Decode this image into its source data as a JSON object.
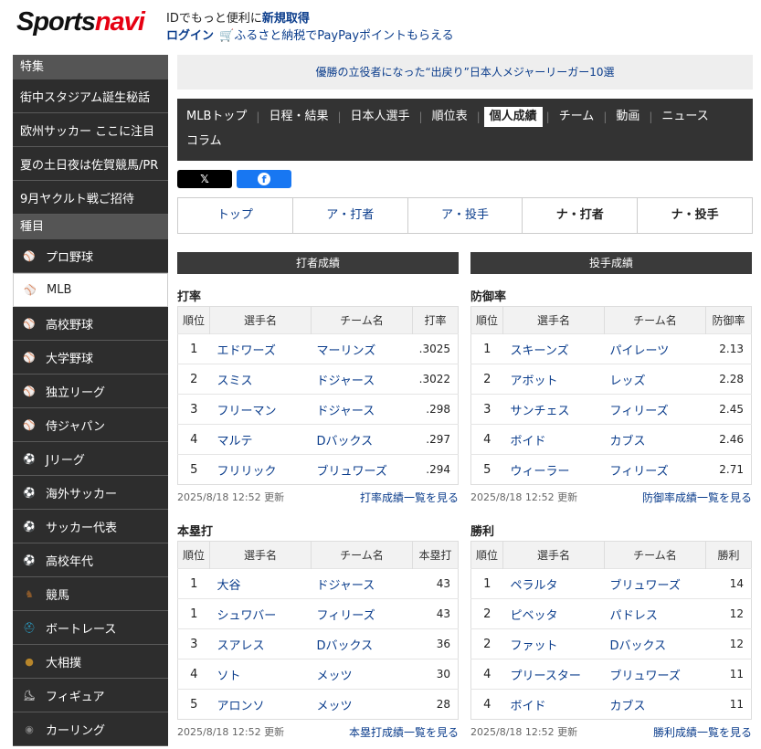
{
  "header": {
    "logo_main": "Sports",
    "logo_accent": "navi",
    "id_text": "IDでもっと便利に",
    "register": "新規取得",
    "login": "ログイン",
    "furusato": "ふるさと納税でPayPayポイントもらえる"
  },
  "sidebar": {
    "features_head": "特集",
    "features": [
      "街中スタジアム誕生秘話",
      "欧州サッカー ここに注目",
      "夏の土日夜は佐賀競馬/PR",
      "9月ヤクルト戦ご招待"
    ],
    "sports_head": "種目",
    "sports": [
      {
        "label": "プロ野球",
        "icon": "baseball-bat-icon",
        "color": "#888888"
      },
      {
        "label": "MLB",
        "icon": "mlb-icon",
        "color": "#d0021b"
      },
      {
        "label": "高校野球",
        "icon": "baseball-bat-icon",
        "color": "#999999"
      },
      {
        "label": "大学野球",
        "icon": "baseball-bat-icon",
        "color": "#2e8b57"
      },
      {
        "label": "独立リーグ",
        "icon": "baseball-bat-icon",
        "color": "#e8782a"
      },
      {
        "label": "侍ジャパン",
        "icon": "baseball-bat-icon",
        "color": "#1f4fa0"
      },
      {
        "label": "Jリーグ",
        "icon": "soccer-ball-icon",
        "color": "#ffffff"
      },
      {
        "label": "海外サッカー",
        "icon": "soccer-ball-icon",
        "color": "#e8452a"
      },
      {
        "label": "サッカー代表",
        "icon": "soccer-ball-icon",
        "color": "#1f4fa0"
      },
      {
        "label": "高校年代",
        "icon": "soccer-ball-icon",
        "color": "#1f8fd0"
      },
      {
        "label": "競馬",
        "icon": "horse-icon",
        "color": "#8b5a2b"
      },
      {
        "label": "ボートレース",
        "icon": "helmet-icon",
        "color": "#2aa0c8"
      },
      {
        "label": "大相撲",
        "icon": "sumo-icon",
        "color": "#b8862b"
      },
      {
        "label": "フィギュア",
        "icon": "skate-icon",
        "color": "#dddddd"
      },
      {
        "label": "カーリング",
        "icon": "curling-stone-icon",
        "color": "#888888"
      }
    ],
    "active_index": 1
  },
  "banner": "優勝の立役者になった“出戻り”日本人メジャーリーガー10選",
  "nav": {
    "row1": [
      {
        "label": "MLBトップ",
        "active": false
      },
      {
        "label": "日程・結果",
        "active": false
      },
      {
        "label": "日本人選手",
        "active": false
      },
      {
        "label": "順位表",
        "active": false
      },
      {
        "label": "個人成績",
        "active": true
      },
      {
        "label": "チーム",
        "active": false
      },
      {
        "label": "動画",
        "active": false
      },
      {
        "label": "ニュース",
        "active": false
      }
    ],
    "row2": [
      {
        "label": "コラム",
        "active": false
      }
    ]
  },
  "share": {
    "x": "𝕏",
    "fb": "f"
  },
  "subnav": [
    {
      "label": "トップ",
      "bold": false
    },
    {
      "label": "ア・打者",
      "bold": false
    },
    {
      "label": "ア・投手",
      "bold": false
    },
    {
      "label": "ナ・打者",
      "bold": true
    },
    {
      "label": "ナ・投手",
      "bold": true
    }
  ],
  "batting_head": "打者成績",
  "pitching_head": "投手成績",
  "tables": {
    "avg": {
      "title": "打率",
      "headers": [
        "順位",
        "選手名",
        "チーム名",
        "打率"
      ],
      "rows": [
        [
          "1",
          "エドワーズ",
          "マーリンズ",
          ".3025"
        ],
        [
          "2",
          "スミス",
          "ドジャース",
          ".3022"
        ],
        [
          "3",
          "フリーマン",
          "ドジャース",
          ".298"
        ],
        [
          "4",
          "マルテ",
          "Dバックス",
          ".297"
        ],
        [
          "5",
          "フリリック",
          "ブリュワーズ",
          ".294"
        ]
      ],
      "updated": "2025/8/18 12:52 更新",
      "more": "打率成績一覧を見る"
    },
    "era": {
      "title": "防御率",
      "headers": [
        "順位",
        "選手名",
        "チーム名",
        "防御率"
      ],
      "rows": [
        [
          "1",
          "スキーンズ",
          "パイレーツ",
          "2.13"
        ],
        [
          "2",
          "アボット",
          "レッズ",
          "2.28"
        ],
        [
          "3",
          "サンチェス",
          "フィリーズ",
          "2.45"
        ],
        [
          "4",
          "ボイド",
          "カブス",
          "2.46"
        ],
        [
          "5",
          "ウィーラー",
          "フィリーズ",
          "2.71"
        ]
      ],
      "updated": "2025/8/18 12:52 更新",
      "more": "防御率成績一覧を見る"
    },
    "hr": {
      "title": "本塁打",
      "headers": [
        "順位",
        "選手名",
        "チーム名",
        "本塁打"
      ],
      "rows": [
        [
          "1",
          "大谷",
          "ドジャース",
          "43"
        ],
        [
          "1",
          "シュワバー",
          "フィリーズ",
          "43"
        ],
        [
          "3",
          "スアレス",
          "Dバックス",
          "36"
        ],
        [
          "4",
          "ソト",
          "メッツ",
          "30"
        ],
        [
          "5",
          "アロンソ",
          "メッツ",
          "28"
        ]
      ],
      "updated": "2025/8/18 12:52 更新",
      "more": "本塁打成績一覧を見る"
    },
    "wins": {
      "title": "勝利",
      "headers": [
        "順位",
        "選手名",
        "チーム名",
        "勝利"
      ],
      "rows": [
        [
          "1",
          "ペラルタ",
          "ブリュワーズ",
          "14"
        ],
        [
          "2",
          "ピベッタ",
          "パドレス",
          "12"
        ],
        [
          "2",
          "ファット",
          "Dバックス",
          "12"
        ],
        [
          "4",
          "プリースター",
          "ブリュワーズ",
          "11"
        ],
        [
          "4",
          "ボイド",
          "カブス",
          "11"
        ]
      ],
      "updated": "2025/8/18 12:52 更新",
      "more": "勝利成績一覧を見る"
    }
  }
}
